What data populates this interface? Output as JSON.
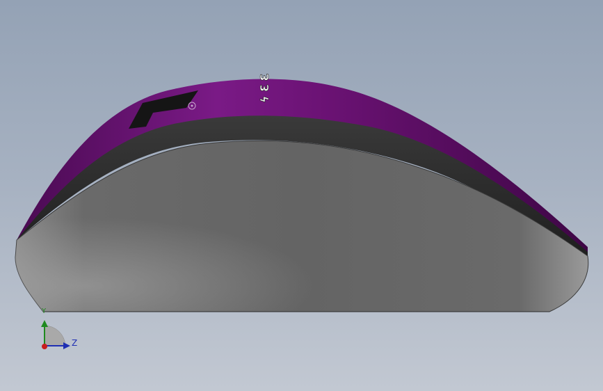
{
  "viewport": {
    "background_top": "#94a2b5",
    "background_bottom": "#c2c8d2"
  },
  "model": {
    "shell_color": "#6f127a",
    "grip_color": "#2b2b2b",
    "side_color": "#6b6b6b",
    "emboss_text": "ϟ ℇ ℇ"
  },
  "triad": {
    "y_label": "Y",
    "z_label": "Z",
    "y_color": "#1f8a1f",
    "z_color": "#1f2fb3",
    "x_color": "#c81e1e"
  }
}
